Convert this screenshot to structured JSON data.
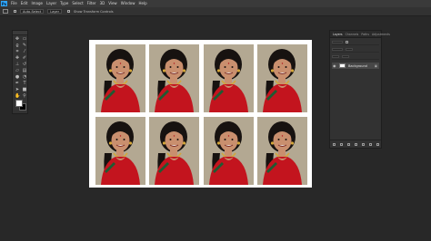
{
  "app": {
    "logo": "Ps",
    "accent": "#31a8ff"
  },
  "menu": [
    "File",
    "Edit",
    "Image",
    "Layer",
    "Type",
    "Select",
    "Filter",
    "3D",
    "View",
    "Window",
    "Help"
  ],
  "options": {
    "fields": [
      "Auto-Select",
      "Layer"
    ],
    "label": "Show Transform Controls"
  },
  "tools": [
    "move-icon",
    "marquee-icon",
    "lasso-icon",
    "quick-select-icon",
    "crop-icon",
    "eyedropper-icon",
    "healing-icon",
    "brush-icon",
    "stamp-icon",
    "history-brush-icon",
    "eraser-icon",
    "gradient-icon",
    "blur-icon",
    "dodge-icon",
    "pen-icon",
    "type-icon",
    "path-select-icon",
    "shape-icon",
    "hand-icon",
    "zoom-icon"
  ],
  "layers_panel": {
    "tabs": [
      "Layers",
      "Channels",
      "Paths",
      "Adjustments"
    ],
    "layer": {
      "name": "Background"
    }
  },
  "canvas": {
    "background": "#ffffff",
    "photo_rows": 2,
    "photo_cols": 4
  },
  "colors": {
    "saree": "#c3141e",
    "hair": "#171210",
    "skin": "#c98f6e",
    "backdrop": "#b3a892"
  }
}
